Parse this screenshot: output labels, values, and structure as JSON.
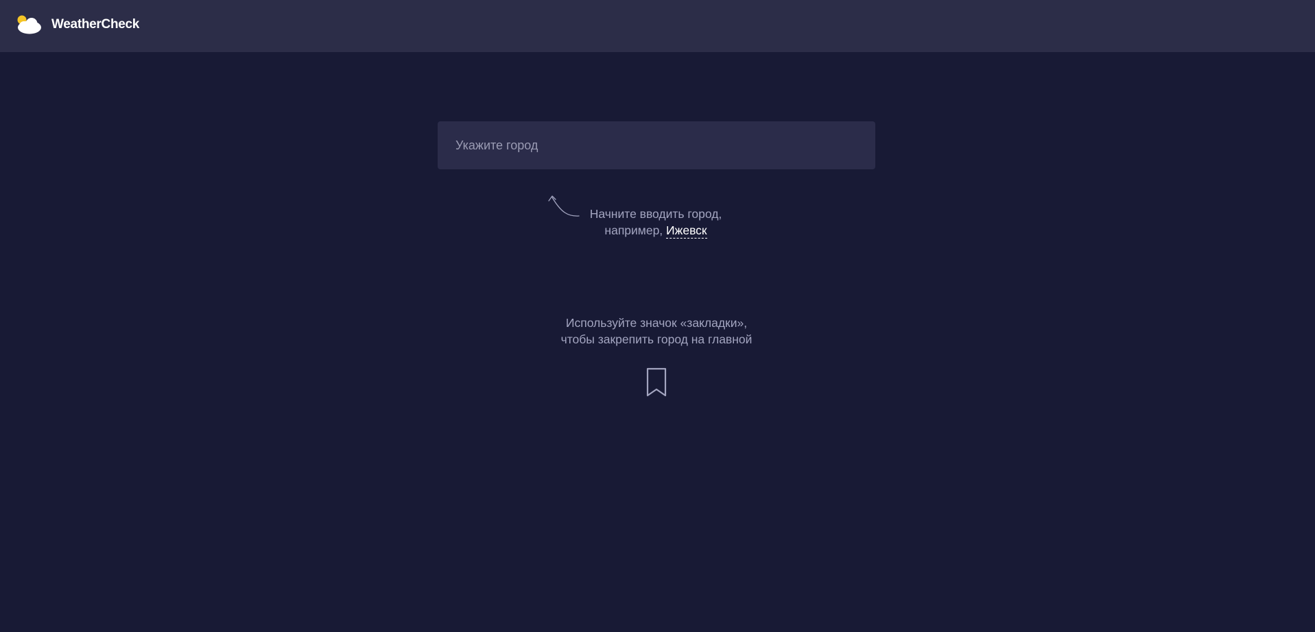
{
  "header": {
    "app_name": "WeatherCheck",
    "logo_icon": "sun-cloud-icon"
  },
  "search": {
    "value": "",
    "placeholder": "Укажите город"
  },
  "hint": {
    "line1": "Начните вводить город,",
    "line2_prefix": "например,",
    "example_city": "Ижевск"
  },
  "bookmark_hint": {
    "line1": "Используйте значок «закладки»,",
    "line2": "чтобы закрепить город на главной",
    "icon": "bookmark-icon"
  },
  "colors": {
    "background": "#181a35",
    "header_background": "#2c2d48",
    "input_background": "#2b2c4a",
    "muted_text": "#a3a5c0",
    "sun": "#f5c527"
  }
}
